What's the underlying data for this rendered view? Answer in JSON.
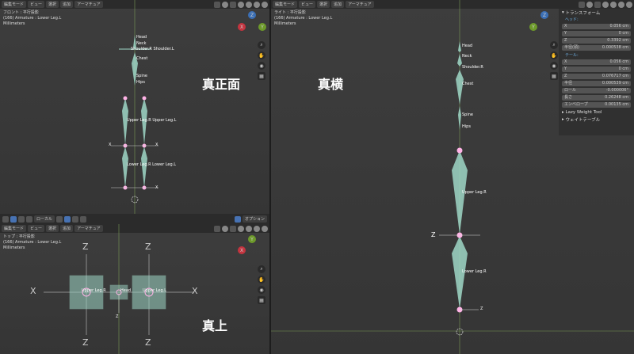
{
  "menu": {
    "mode": "編集モード",
    "view": "ビュー",
    "select": "選択",
    "add": "追加",
    "armature": "アーマチュア"
  },
  "front": {
    "view_name": "フロント : 平行投影",
    "object_info": "(166) Armature : Lower Leg.L",
    "units": "Millimeters",
    "caption": "真正面",
    "bones": {
      "head": "Head",
      "neck": "Neck",
      "shoulders": "Shoulder.R Shoulder.L",
      "chest": "Chest",
      "spine": "Spine",
      "hips": "Hips",
      "upper": "Upper Leg.R Upper Leg.L",
      "lower": "Lower Leg.R Lower Leg.L"
    },
    "axis_x": "X"
  },
  "top": {
    "view_name": "トップ : 平行投影",
    "object_info": "(166) Armature : Lower Leg.L",
    "units": "Millimeters",
    "caption": "真上",
    "bones": {
      "left": "Upper Leg.R",
      "center": "Head",
      "right": "Upper Leg.L"
    },
    "axis_x": "X",
    "axis_z": "Z"
  },
  "right": {
    "view_name": "ライト : 平行投影",
    "object_info": "(166) Armature : Lower Leg.L",
    "units": "Millimeters",
    "caption": "真横",
    "bones": {
      "head": "Head",
      "neck": "Neck",
      "shoulder": "Shoulder.R",
      "chest": "Chest",
      "spine": "Spine",
      "hips": "Hips",
      "upper": "Upper Leg.R",
      "lower": "Lower Leg.R"
    },
    "axis_z": "Z"
  },
  "toolbar2": {
    "orientation": "ローカル",
    "options": "オプション"
  },
  "transform": {
    "title": "トランスフォーム",
    "head_label": "ヘッド:",
    "tail_label": "テール:",
    "head": {
      "x_key": "X",
      "x": "0.056 cm",
      "y_key": "Y",
      "y": "0 cm",
      "z_key": "Z",
      "z": "0.3392 cm",
      "r_key": "半径(頭)",
      "r": "0.000538 cm"
    },
    "tail": {
      "x_key": "X",
      "x": "0.056 cm",
      "y_key": "Y",
      "y": "0 cm",
      "z_key": "Z",
      "z": "0.076717 cm",
      "r_key": "半径",
      "r": "0.000539 cm"
    },
    "roll_key": "ロール",
    "roll": "-0.000006°",
    "length_key": "長さ",
    "length": "0.26248 cm",
    "env_key": "エンベロープ",
    "env": "0.00135 cm",
    "lazy": "Lazy Weight Tool",
    "weight_table": "ウェイトテーブル"
  },
  "colors": {
    "bone": "#9fd7c7",
    "selected": "#ffb3e6",
    "accent": "#4772b3"
  }
}
